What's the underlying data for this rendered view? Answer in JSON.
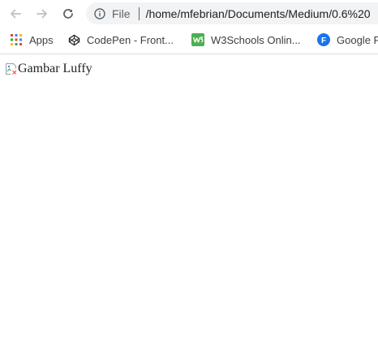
{
  "toolbar": {
    "scheme_label": "File",
    "url": "/home/mfebrian/Documents/Medium/0.6%20",
    "back_icon": "back-arrow-icon",
    "forward_icon": "forward-arrow-icon",
    "reload_icon": "reload-icon",
    "info_icon": "info-icon"
  },
  "bookmarks": {
    "items": [
      {
        "label": "Apps",
        "icon": "apps-grid-icon"
      },
      {
        "label": "CodePen - Front...",
        "icon": "codepen-icon"
      },
      {
        "label": "W3Schools Onlin...",
        "icon": "w3schools-icon"
      },
      {
        "label": "Google F",
        "icon": "google-forms-icon"
      }
    ]
  },
  "page": {
    "image_alt": "Gambar Luffy"
  },
  "colors": {
    "omnibox_bg": "#f1f3f4",
    "icon_gray": "#5f6368",
    "w3schools_green": "#4caf50",
    "google_blue": "#1a73e8"
  }
}
